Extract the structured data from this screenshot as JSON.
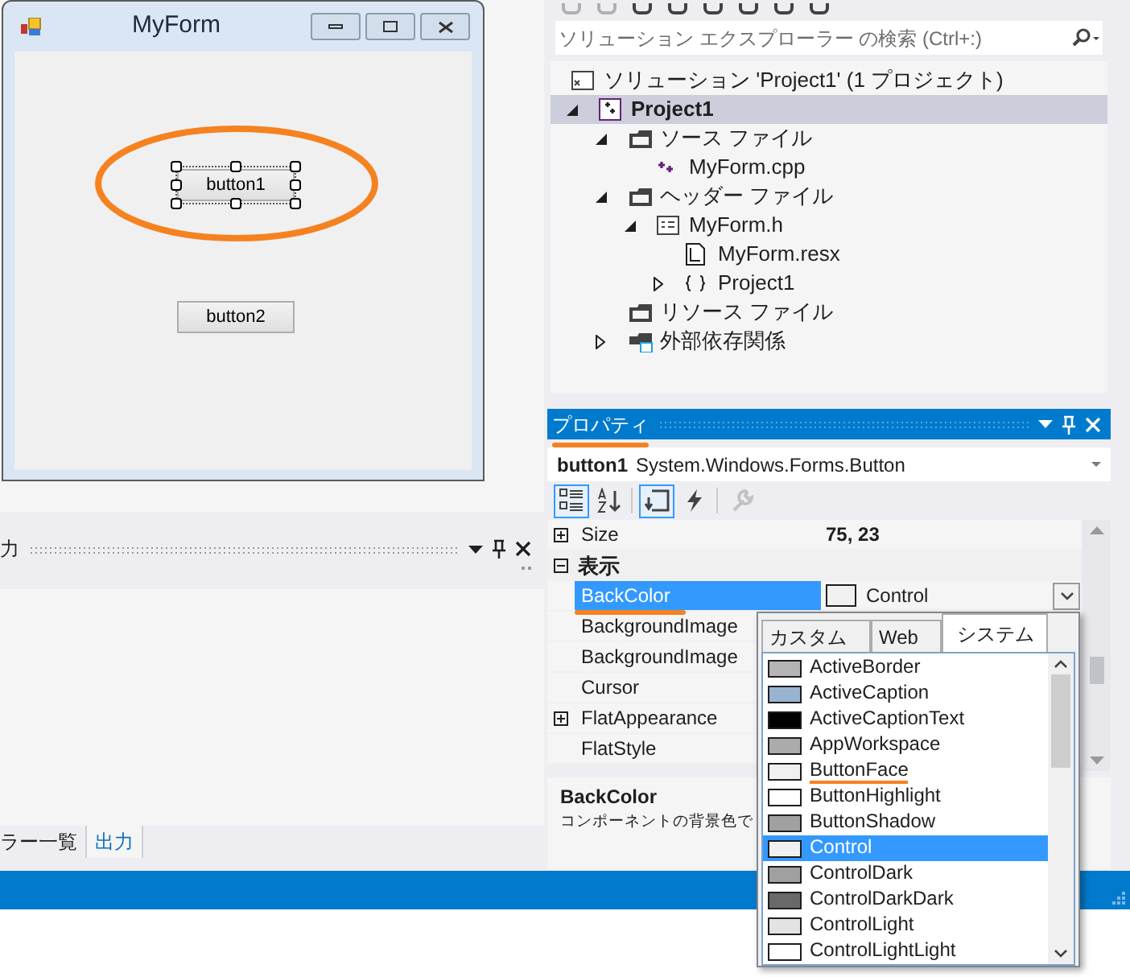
{
  "form_window": {
    "title": "MyForm",
    "selection_circled": true,
    "buttons": [
      {
        "label": "button1",
        "selected": true
      },
      {
        "label": "button2",
        "selected": false
      }
    ]
  },
  "output_panel": {
    "title": "力",
    "tabs": [
      {
        "label": "ラー一覧",
        "selected": false
      },
      {
        "label": "出力",
        "selected": true
      }
    ]
  },
  "solution_explorer": {
    "search": {
      "placeholder": "ソリューション エクスプローラー の検索 (Ctrl+:)"
    },
    "tree": [
      {
        "label": "ソリューション 'Project1' (1 プロジェクト)",
        "kind": "solution",
        "selected": false,
        "children": [
          {
            "label": "Project1",
            "kind": "project",
            "selected": true,
            "expanded": true,
            "children": [
              {
                "label": "ソース ファイル",
                "kind": "filter",
                "selected": false,
                "expanded": true,
                "children": [
                  {
                    "label": "MyForm.cpp",
                    "kind": "cpp",
                    "selected": false
                  }
                ]
              },
              {
                "label": "ヘッダー ファイル",
                "kind": "filter",
                "selected": false,
                "expanded": true,
                "children": [
                  {
                    "label": "MyForm.h",
                    "kind": "header",
                    "selected": false,
                    "expanded": true,
                    "children": [
                      {
                        "label": "MyForm.resx",
                        "kind": "resx",
                        "selected": false
                      },
                      {
                        "label": "Project1",
                        "kind": "namespace",
                        "selected": false,
                        "expanded": false
                      }
                    ]
                  }
                ]
              },
              {
                "label": "リソース ファイル",
                "kind": "filter",
                "selected": false
              },
              {
                "label": "外部依存関係",
                "kind": "external",
                "selected": false,
                "expanded": false
              }
            ]
          }
        ]
      }
    ]
  },
  "properties": {
    "title": "プロパティ",
    "title_annotated": true,
    "object_name": "button1",
    "object_type": "System.Windows.Forms.Button",
    "toolbar": [
      {
        "kind": "categorized",
        "selected": true
      },
      {
        "kind": "alphabetical",
        "selected": false
      },
      {
        "kind": "props",
        "selected": true
      },
      {
        "kind": "events",
        "selected": false
      },
      {
        "kind": "pages",
        "selected": false,
        "disabled": true
      }
    ],
    "rows": [
      {
        "kind": "property",
        "name": "Size",
        "value": "75, 23",
        "value_bold": true,
        "expanded": false,
        "selected": false
      },
      {
        "kind": "category",
        "name": "表示",
        "expanded": true
      },
      {
        "kind": "color",
        "name": "BackColor",
        "value": "Control",
        "color": "#f0f0f0",
        "selected": true,
        "annotated": true
      },
      {
        "kind": "property",
        "name": "BackgroundImage",
        "selected": false
      },
      {
        "kind": "property",
        "name": "BackgroundImage",
        "selected": false
      },
      {
        "kind": "property",
        "name": "Cursor",
        "selected": false
      },
      {
        "kind": "property",
        "name": "FlatAppearance",
        "expanded": false,
        "selected": false
      },
      {
        "kind": "property",
        "name": "FlatStyle",
        "selected": false
      }
    ],
    "description": {
      "title": "BackColor",
      "text": "コンポーネントの背景色で"
    }
  },
  "color_popup": {
    "tabs": [
      {
        "label": "カスタム",
        "selected": false
      },
      {
        "label": "Web",
        "selected": false
      },
      {
        "label": "システム",
        "selected": true
      }
    ],
    "items": [
      {
        "name": "ActiveBorder",
        "color": "#b4b4b4",
        "selected": false,
        "annotated": false
      },
      {
        "name": "ActiveCaption",
        "color": "#99b4d1",
        "selected": false,
        "annotated": false
      },
      {
        "name": "ActiveCaptionText",
        "color": "#000000",
        "selected": false,
        "annotated": false
      },
      {
        "name": "AppWorkspace",
        "color": "#ababab",
        "selected": false,
        "annotated": false
      },
      {
        "name": "ButtonFace",
        "color": "#f0f0f0",
        "selected": false,
        "annotated": true
      },
      {
        "name": "ButtonHighlight",
        "color": "#ffffff",
        "selected": false,
        "annotated": false
      },
      {
        "name": "ButtonShadow",
        "color": "#a0a0a0",
        "selected": false,
        "annotated": false
      },
      {
        "name": "Control",
        "color": "#f0f0f0",
        "selected": true,
        "annotated": false
      },
      {
        "name": "ControlDark",
        "color": "#a0a0a0",
        "selected": false,
        "annotated": false
      },
      {
        "name": "ControlDarkDark",
        "color": "#696969",
        "selected": false,
        "annotated": false
      },
      {
        "name": "ControlLight",
        "color": "#e3e3e3",
        "selected": false,
        "annotated": false
      },
      {
        "name": "ControlLightLight",
        "color": "#ffffff",
        "selected": false,
        "annotated": false
      }
    ]
  }
}
